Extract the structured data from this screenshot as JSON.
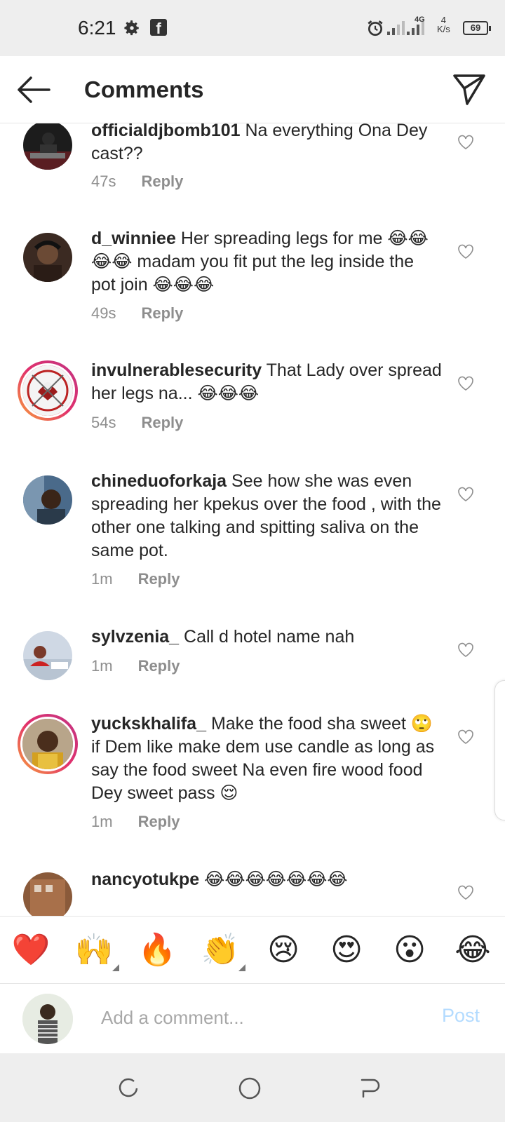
{
  "status_bar": {
    "time": "6:21",
    "network": "4G",
    "speed_value": "4",
    "speed_unit": "K/s",
    "battery": "69"
  },
  "header": {
    "title": "Comments"
  },
  "comments": [
    {
      "username": "officialdjbomb101",
      "text": "Na everything Ona Dey cast??",
      "time": "47s",
      "reply": "Reply"
    },
    {
      "username": "d_winniee",
      "text": "Her spreading legs for me 😂😂😂😂 madam you fit put the leg inside the pot join 😂😂😂",
      "time": "49s",
      "reply": "Reply"
    },
    {
      "username": "invulnerablesecurity",
      "text": "That Lady over spread her legs na... 😂😂😂",
      "time": "54s",
      "reply": "Reply"
    },
    {
      "username": "chineduoforkaja",
      "text": "See how she was even spreading her kpekus over the food , with the other one talking and spitting saliva on the same pot.",
      "time": "1m",
      "reply": "Reply"
    },
    {
      "username": "sylvzenia_",
      "text": "Call d hotel name nah",
      "time": "1m",
      "reply": "Reply"
    },
    {
      "username": "yuckskhalifa_",
      "text": "Make the food sha sweet 🙄 if Dem like make dem use candle as long as say the food sweet Na even fire wood food Dey sweet pass 😌",
      "time": "1m",
      "reply": "Reply"
    },
    {
      "username": "nancyotukpe",
      "text": "😂😂😂😂😂😂😂",
      "time": "",
      "reply": ""
    }
  ],
  "emoji_bar": [
    "❤️",
    "🙌",
    "🔥",
    "👏",
    "😢",
    "😍",
    "😮",
    "😂"
  ],
  "add_comment": {
    "placeholder": "Add a comment...",
    "post_label": "Post"
  },
  "colors": {
    "accent_post_disabled": "#b3dbff",
    "story_ring_start": "#f9a33b",
    "story_ring_end": "#c13584",
    "muted": "#8e8e8e"
  }
}
